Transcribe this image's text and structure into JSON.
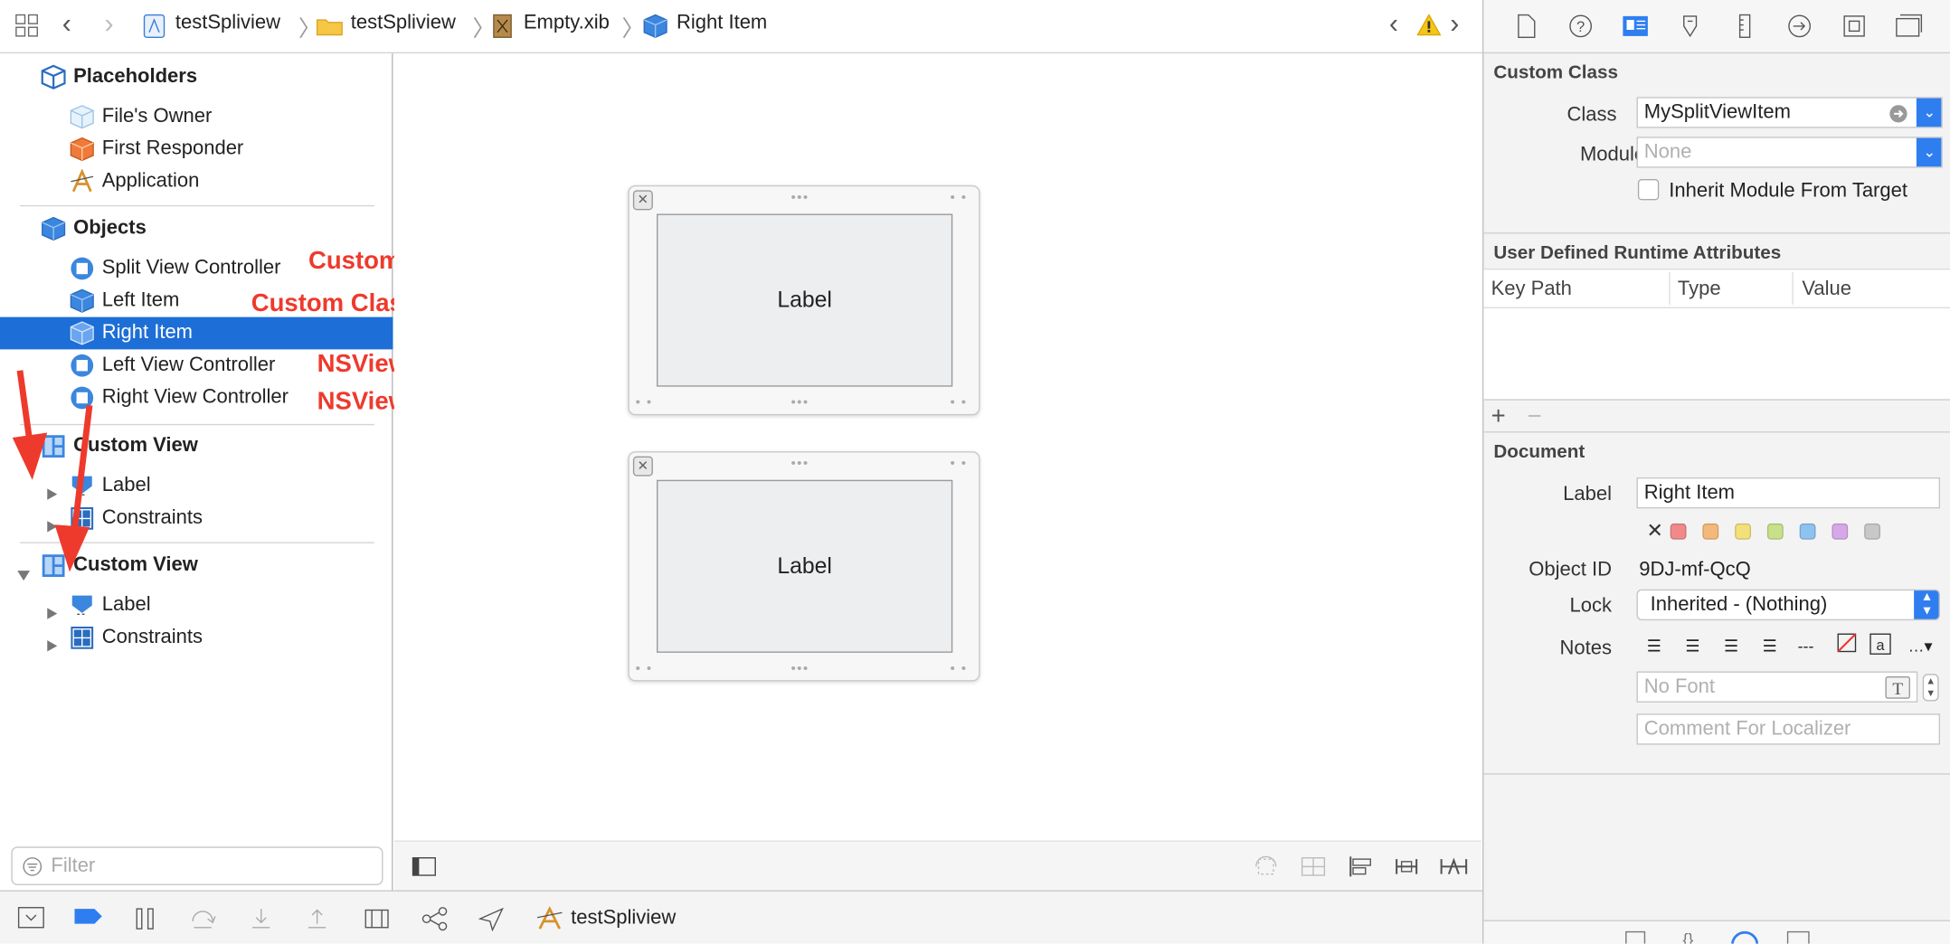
{
  "breadcrumb": [
    "testSpliview",
    "testSpliview",
    "Empty.xib",
    "Right Item"
  ],
  "outline": {
    "placeholders_title": "Placeholders",
    "placeholders": [
      "File's Owner",
      "First Responder",
      "Application"
    ],
    "objects_title": "Objects",
    "objects": [
      "Split View Controller",
      "Left Item",
      "Right Item",
      "Left View Controller",
      "Right View Controller"
    ],
    "custom_view_1": {
      "title": "Custom View",
      "children": [
        "Label",
        "Constraints"
      ]
    },
    "custom_view_2": {
      "title": "Custom View",
      "children": [
        "Label",
        "Constraints"
      ]
    },
    "selected": "Right Item",
    "filter_placeholder": "Filter"
  },
  "annotations": [
    "Custom Class NSSplitViewController",
    "Custom Class MySplitViewItem",
    "NSViewController",
    "NSViewController"
  ],
  "canvas": {
    "view_labels": [
      "Label",
      "Label"
    ]
  },
  "bottombar": {
    "scheme": "testSpliview"
  },
  "inspector": {
    "custom_class": {
      "title": "Custom Class",
      "class_label": "Class",
      "class_value": "MySplitViewItem",
      "module_label": "Module",
      "module_placeholder": "None",
      "inherit_label": "Inherit Module From Target"
    },
    "runtime_attrs": {
      "title": "User Defined Runtime Attributes",
      "columns": [
        "Key Path",
        "Type",
        "Value"
      ]
    },
    "document": {
      "title": "Document",
      "label_label": "Label",
      "label_value": "Right Item",
      "object_id_label": "Object ID",
      "object_id_value": "9DJ-mf-QcQ",
      "lock_label": "Lock",
      "lock_value": "Inherited - (Nothing)",
      "notes_label": "Notes",
      "font_placeholder": "No Font",
      "comment_placeholder": "Comment For Localizer"
    },
    "swatch_colors": [
      "#f08a8a",
      "#f4b97a",
      "#f3e07a",
      "#c8e08a",
      "#8ec2f0",
      "#d6a8e8",
      "#c8c8c8"
    ]
  },
  "colors": {
    "selection": "#1d6ed6",
    "annotation": "#ee3a2c",
    "accent": "#2f7ef0"
  }
}
